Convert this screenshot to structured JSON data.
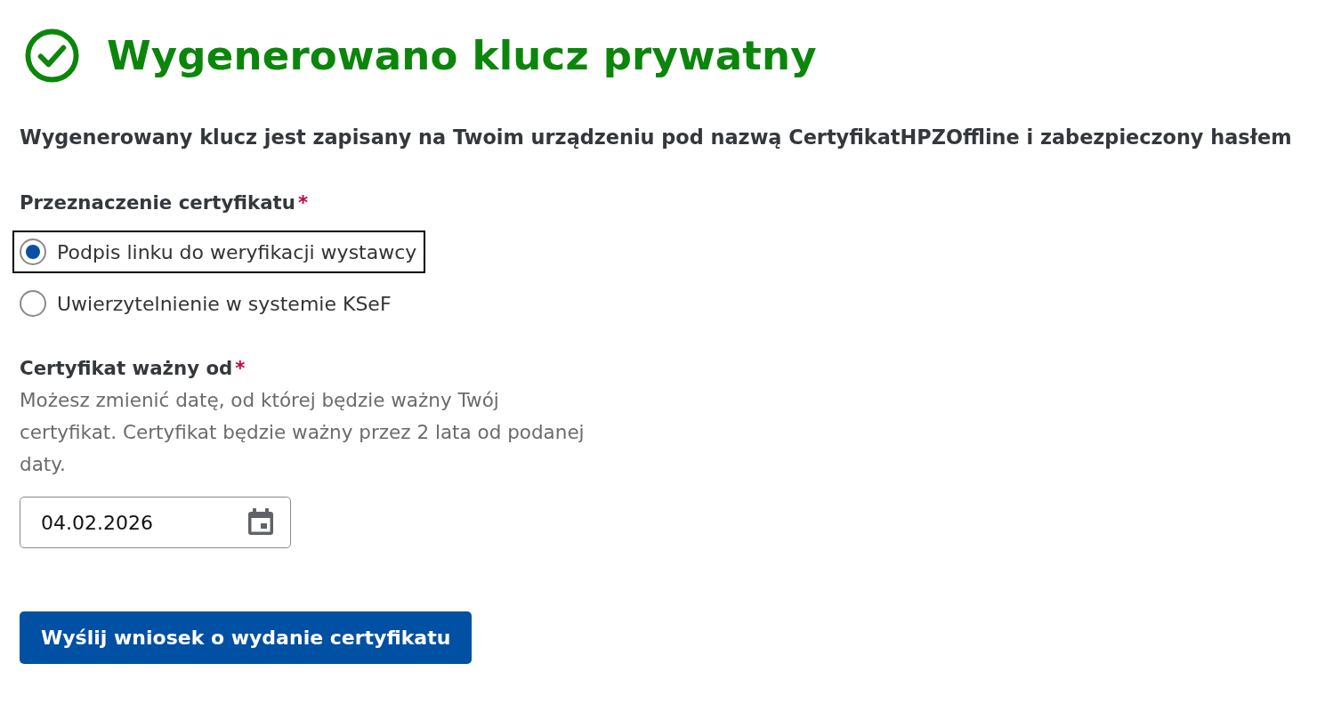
{
  "header": {
    "title": "Wygenerowano klucz prywatny"
  },
  "description": "Wygenerowany klucz jest zapisany na Twoim urządzeniu pod nazwą CertyfikatHPZOffline i zabezpieczony hasłem",
  "purpose": {
    "label": "Przeznaczenie certyfikatu",
    "required_mark": "*",
    "options": [
      {
        "label": "Podpis linku do weryfikacji wystawcy",
        "selected": true,
        "focused": true
      },
      {
        "label": "Uwierzytelnienie w systemie KSeF",
        "selected": false,
        "focused": false
      }
    ]
  },
  "valid_from": {
    "label": "Certyfikat ważny od",
    "required_mark": "*",
    "hint": "Możesz zmienić datę, od której będzie ważny Twój certyfikat. Certyfikat będzie ważny przez 2 lata od podanej daty.",
    "value": "04.02.2026"
  },
  "submit_button": "Wyślij wniosek o wydanie certyfikatu"
}
